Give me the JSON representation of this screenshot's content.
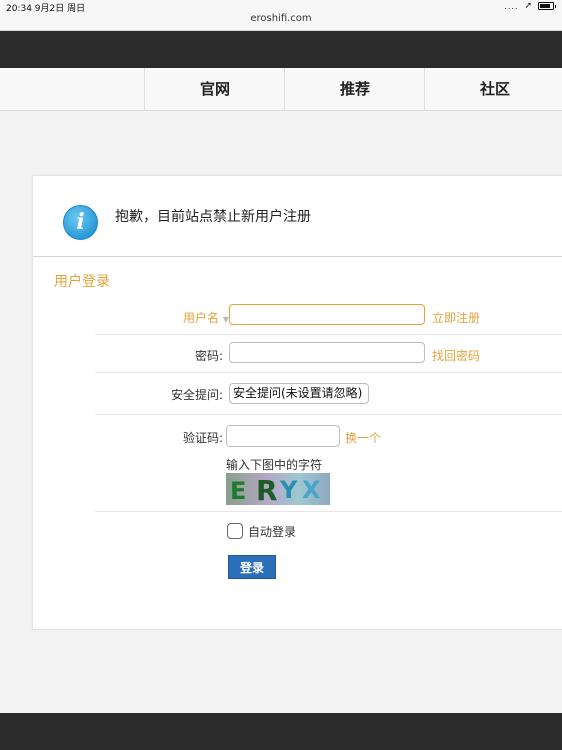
{
  "status": {
    "time_date": "20:34   9月2日 周日",
    "signal": "....",
    "url": "eroshifi.com"
  },
  "nav": {
    "items": [
      {
        "label": "官网"
      },
      {
        "label": "推荐"
      },
      {
        "label": "社区"
      }
    ]
  },
  "notice": {
    "icon": "info-icon",
    "text": "抱歉，目前站点禁止新用户注册"
  },
  "login": {
    "title": "用户登录",
    "username_label": "用户名",
    "username_value": "",
    "register_link": "立即注册",
    "password_label": "密码:",
    "password_value": "",
    "forgot_link": "找回密码",
    "security_label": "安全提问:",
    "security_value": "安全提问(未设置请忽略)",
    "captcha_label": "验证码:",
    "captcha_value": "",
    "captcha_change": "换一个",
    "captcha_hint": "输入下图中的字符",
    "captcha_text": "ERYX",
    "auto_login_label": "自动登录",
    "auto_login_checked": false,
    "submit_label": "登录"
  },
  "colors": {
    "accent": "#e3a33c",
    "button": "#2a6fb8",
    "dark_bar": "#2b2b2b"
  }
}
